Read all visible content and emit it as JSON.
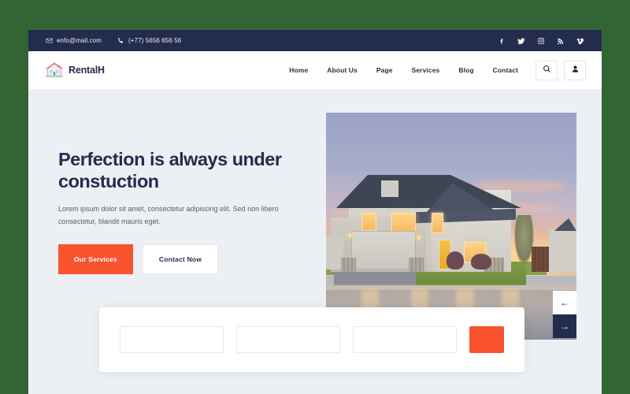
{
  "theme": {
    "page_bg": "#336434",
    "topbar_bg": "#242c4e",
    "accent": "#f9522e",
    "navy": "#242c4e",
    "hero_bg": "#eceff3"
  },
  "topbar": {
    "email": "enfo@mail.com",
    "phone": "(+77) 5656 656 56",
    "socials": [
      {
        "name": "facebook-icon"
      },
      {
        "name": "twitter-icon"
      },
      {
        "name": "instagram-icon"
      },
      {
        "name": "rss-icon"
      },
      {
        "name": "vimeo-icon"
      }
    ]
  },
  "header": {
    "logo_text": "RentalH",
    "nav": [
      {
        "label": "Home"
      },
      {
        "label": "About Us"
      },
      {
        "label": "Page"
      },
      {
        "label": "Services"
      },
      {
        "label": "Blog"
      },
      {
        "label": "Contact"
      }
    ],
    "actions": {
      "search_icon": "search-icon",
      "account_icon": "user-icon"
    }
  },
  "hero": {
    "title": "Perfection is always under constuction",
    "description": "Lorem ipsum dolor sit amet, consectetur adipiscing elit. Sed non libero consectetur, blandit mauris eget.",
    "primary_button": "Our Services",
    "secondary_button": "Contact Now",
    "image_alt": "Suburban two-story house at dusk with lit windows and wet driveway",
    "slider_prev": "←",
    "slider_next": "→"
  },
  "search_form": {
    "field_1_placeholder": "",
    "field_2_placeholder": "",
    "field_3_placeholder": "",
    "submit_label": ""
  }
}
